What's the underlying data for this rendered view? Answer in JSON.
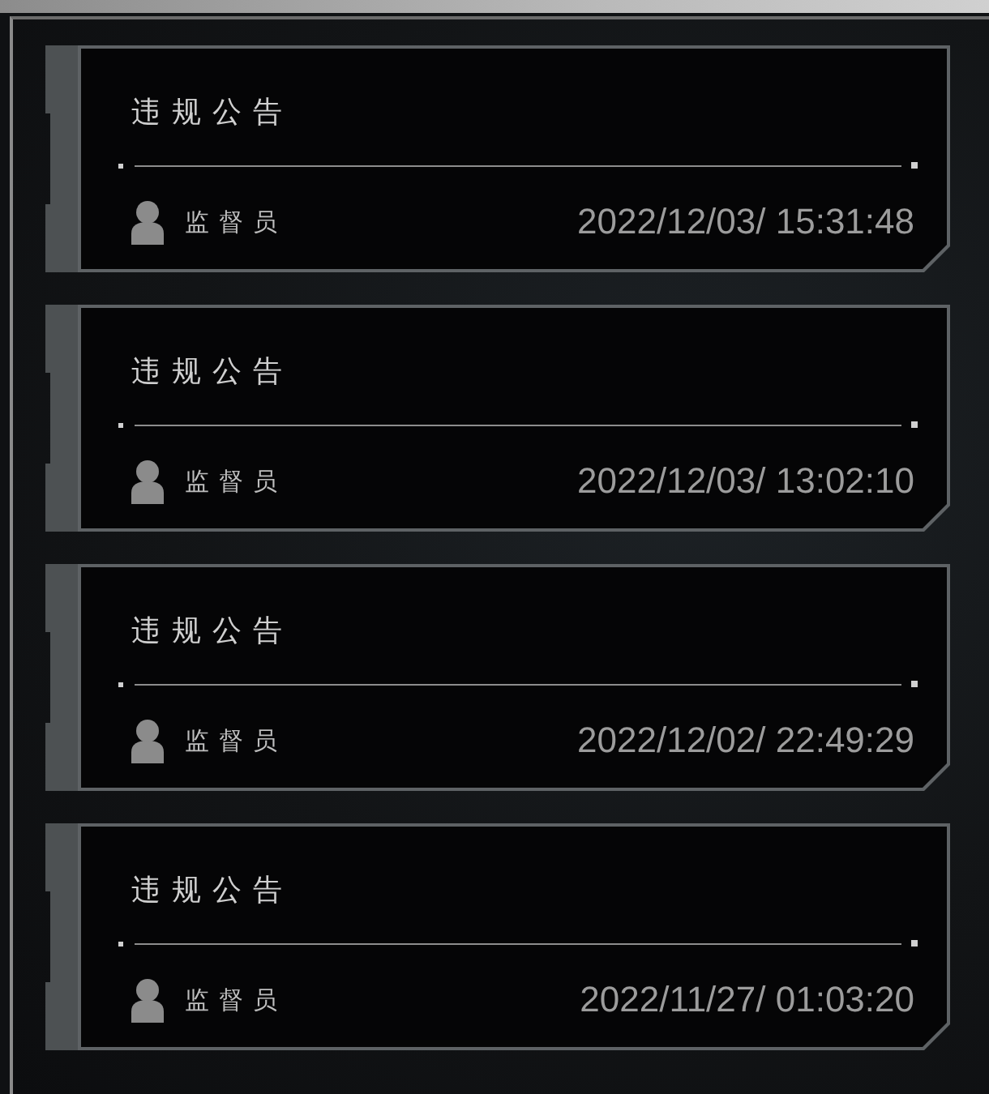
{
  "notices": [
    {
      "title": "违规公告",
      "author": "监督员",
      "time": "2022/12/03/ 15:31:48"
    },
    {
      "title": "违规公告",
      "author": "监督员",
      "time": "2022/12/03/ 13:02:10"
    },
    {
      "title": "违规公告",
      "author": "监督员",
      "time": "2022/12/02/ 22:49:29"
    },
    {
      "title": "违规公告",
      "author": "监督员",
      "time": "2022/11/27/ 01:03:20"
    }
  ]
}
